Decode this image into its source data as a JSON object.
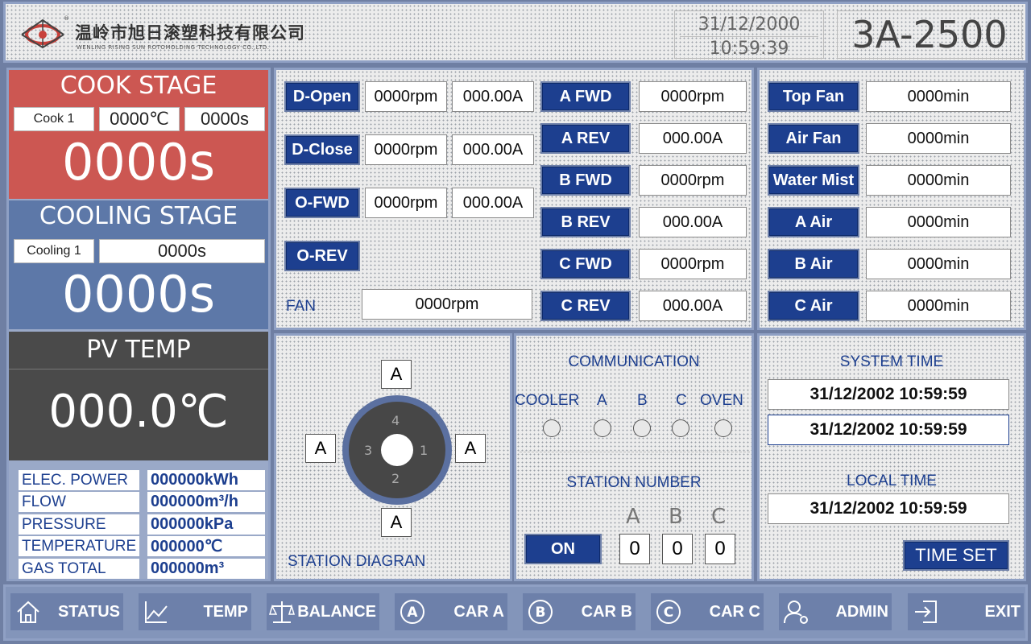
{
  "header": {
    "company_cn": "温岭市旭日滚塑科技有限公司",
    "company_en": "WENLING RISING SUN ROTOMOLDING TECHNOLOGY CO.,LTD.",
    "date": "31/12/2000",
    "time": "10:59:39",
    "model": "3A-2500"
  },
  "cook": {
    "title": "COOK STAGE",
    "step": "Cook 1",
    "temp": "0000℃",
    "time": "0000s",
    "remaining": "0000s"
  },
  "cooling": {
    "title": "COOLING STAGE",
    "step": "Cooling 1",
    "time": "0000s",
    "remaining": "0000s"
  },
  "pv": {
    "title": "PV TEMP",
    "value": "000.0℃"
  },
  "measurements": [
    {
      "label": "ELEC. POWER",
      "value": "000000kWh"
    },
    {
      "label": "FLOW",
      "value": "000000m³/h"
    },
    {
      "label": "PRESSURE",
      "value": "000000kPa"
    },
    {
      "label": "TEMPERATURE",
      "value": "000000℃"
    },
    {
      "label": "GAS TOTAL",
      "value": "000000m³"
    }
  ],
  "door": [
    {
      "label": "D-Open",
      "rpm": "0000rpm",
      "amp": "000.00A"
    },
    {
      "label": "D-Close",
      "rpm": "0000rpm",
      "amp": "000.00A"
    },
    {
      "label": "O-FWD",
      "rpm": "0000rpm",
      "amp": "000.00A"
    },
    {
      "label": "O-REV"
    }
  ],
  "fan": {
    "label": "FAN",
    "rpm": "0000rpm"
  },
  "arms": [
    {
      "label": "A FWD",
      "value": "0000rpm"
    },
    {
      "label": "A REV",
      "value": "000.00A"
    },
    {
      "label": "B FWD",
      "value": "0000rpm"
    },
    {
      "label": "B REV",
      "value": "000.00A"
    },
    {
      "label": "C FWD",
      "value": "0000rpm"
    },
    {
      "label": "C REV",
      "value": "000.00A"
    }
  ],
  "timers": [
    {
      "label": "Top Fan",
      "value": "0000min"
    },
    {
      "label": "Air Fan",
      "value": "0000min"
    },
    {
      "label": "Water Mist",
      "value": "0000min"
    },
    {
      "label": "A Air",
      "value": "0000min"
    },
    {
      "label": "B Air",
      "value": "0000min"
    },
    {
      "label": "C Air",
      "value": "0000min"
    }
  ],
  "diagram": {
    "title": "STATION DIAGRAN",
    "top": "A",
    "left": "A",
    "right": "A",
    "bottom": "A",
    "pos1": "1",
    "pos2": "2",
    "pos3": "3",
    "pos4": "4"
  },
  "communication": {
    "title": "COMMUNICATION",
    "labels": [
      "COOLER",
      "A",
      "B",
      "C",
      "OVEN"
    ]
  },
  "station": {
    "title": "STATION NUMBER",
    "on_label": "ON",
    "letters": [
      "A",
      "B",
      "C"
    ],
    "values": [
      "0",
      "0",
      "0"
    ]
  },
  "system_time": {
    "title": "SYSTEM TIME",
    "value1": "31/12/2002 10:59:59",
    "value2": "31/12/2002 10:59:59"
  },
  "local_time": {
    "title": "LOCAL TIME",
    "value": "31/12/2002 10:59:59",
    "set_label": "TIME SET"
  },
  "nav": [
    {
      "label": "STATUS",
      "icon": "home-icon"
    },
    {
      "label": "TEMP",
      "icon": "chart-line-icon"
    },
    {
      "label": "BALANCE",
      "icon": "balance-icon"
    },
    {
      "label": "CAR A",
      "icon": "circle-a-icon"
    },
    {
      "label": "CAR B",
      "icon": "circle-b-icon"
    },
    {
      "label": "CAR C",
      "icon": "circle-c-icon"
    },
    {
      "label": "ADMIN",
      "icon": "user-gear-icon"
    },
    {
      "label": "EXIT",
      "icon": "exit-icon"
    }
  ],
  "colors": {
    "cook": "#cc5752",
    "cooling": "#5d78a8",
    "pv": "#4a4a4a",
    "button": "#1d3f8f",
    "frame": "#8fa0c4"
  }
}
